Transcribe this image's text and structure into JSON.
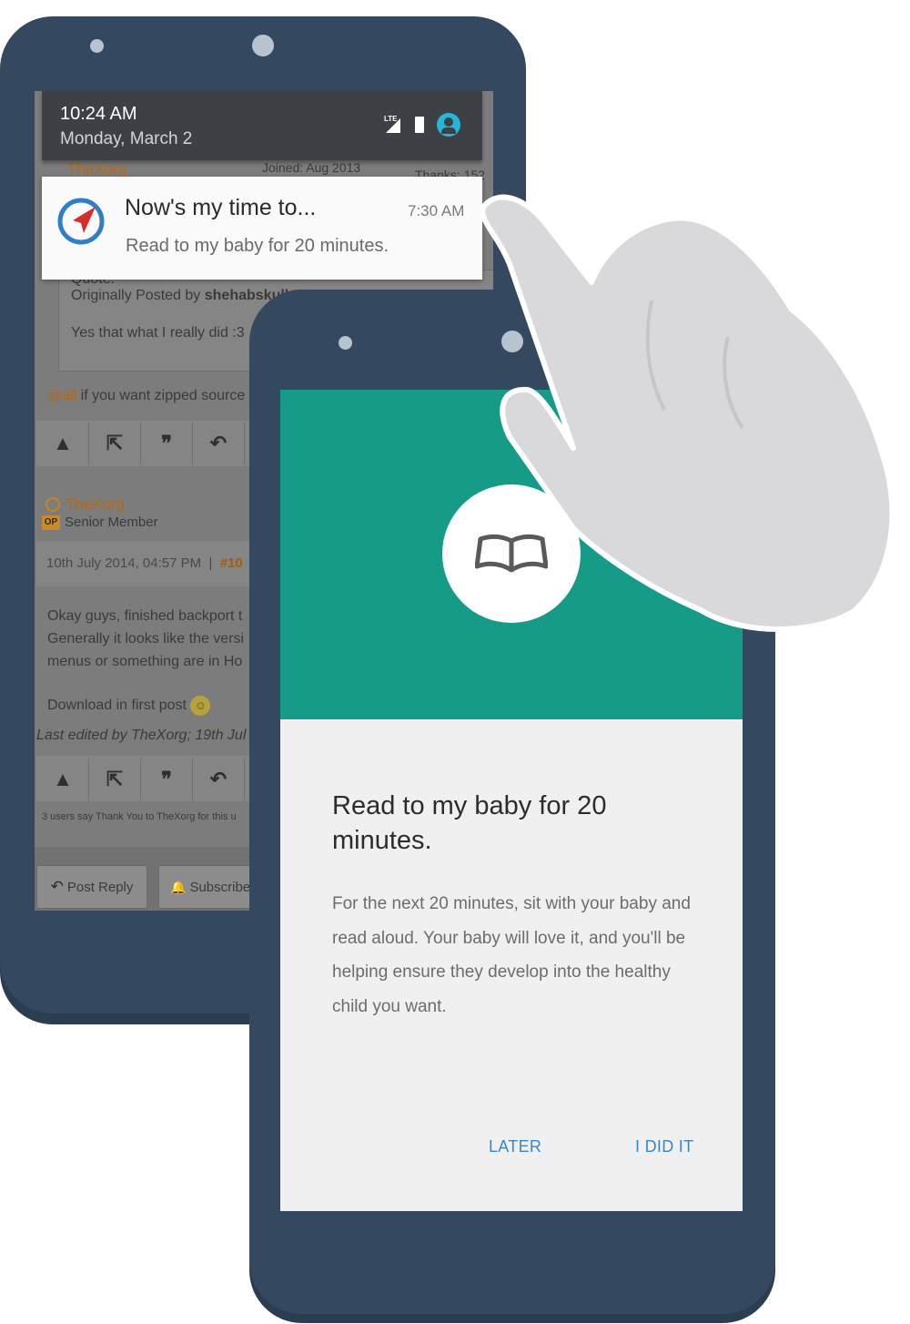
{
  "status_bar": {
    "time": "10:24 AM",
    "date": "Monday, March 2",
    "network": "LTE"
  },
  "notification": {
    "title": "Now's my time to...",
    "time": "7:30 AM",
    "text": "Read to my baby for 20 minutes."
  },
  "forum": {
    "top_poster": "TheXorg",
    "top_joined": "Joined: Aug 2013",
    "top_thanks": "Thanks: 152",
    "quote_label": "Quote:",
    "quote_prefix": "Originally Posted by",
    "quote_author": "shehabskull",
    "quote_text": "Yes that what I really did :3",
    "mention": "@all",
    "mention_text": "if you want zipped source",
    "post_author": "TheXorg",
    "op_badge": "OP",
    "post_role": "Senior Member",
    "post_date": "10th July 2014, 04:57 PM",
    "post_sep": "|",
    "post_number": "#10",
    "post_lines": [
      "Okay guys, finished backport t",
      "Generally it looks like the versi",
      "menus or something are in Ho"
    ],
    "download_text": "Download in first post",
    "last_edited": "Last edited by TheXorg; 19th Jul",
    "thanks_line": "3 users say Thank You to TheXorg for this u",
    "post_reply": "Post Reply",
    "subscribe": "Subscribe"
  },
  "card": {
    "title": "Read to my baby for 20 minutes.",
    "body": "For the next 20 minutes, sit with your baby and read aloud. Your baby will love it, and you'll be helping ensure they develop into the healthy child you want.",
    "later_label": "LATER",
    "done_label": "I DID IT"
  },
  "icons": {
    "app": "compass-arrow-icon",
    "card": "open-book-icon",
    "actions": [
      "warning-icon",
      "share-icon",
      "quote-icon",
      "reply-icon"
    ]
  },
  "colors": {
    "phone_body": "#34495f",
    "card_header": "#179b89",
    "button_text": "#3a87c8",
    "app_icon_red": "#d32f2f",
    "app_icon_blue": "#2e7fc4"
  }
}
